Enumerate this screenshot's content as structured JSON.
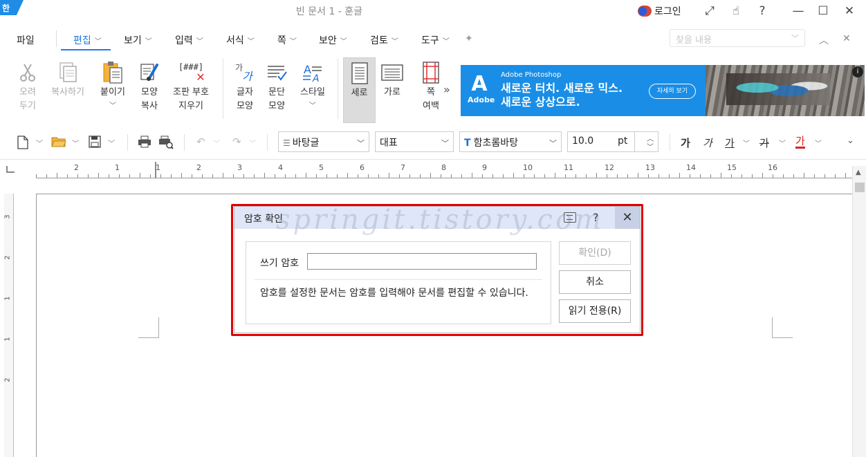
{
  "window": {
    "title": "빈 문서 1 - 훈글",
    "corner_badge": "한",
    "login_label": "로그인",
    "controls": [
      "expand-icon",
      "hand-icon",
      "help-icon",
      "minimize-icon",
      "maximize-icon",
      "close-icon"
    ]
  },
  "menu": {
    "file": "파일",
    "items": [
      "편집",
      "보기",
      "입력",
      "서식",
      "쪽",
      "보안",
      "검토",
      "도구"
    ],
    "active_index": 0,
    "search_placeholder": "찾을 내용"
  },
  "ribbon": {
    "cut": [
      "오려",
      "두기"
    ],
    "copy": "복사하기",
    "paste": "붙이기",
    "shape_copy": [
      "모양",
      "복사"
    ],
    "clear_codes": [
      "조판 부호",
      "지우기"
    ],
    "clear_codes_glyph": "[###]",
    "char_shape": [
      "글자",
      "모양"
    ],
    "para_shape": [
      "문단",
      "모양"
    ],
    "style": "스타일",
    "portrait": "세로",
    "landscape": "가로",
    "margin": [
      "쪽",
      "여백"
    ],
    "more": "»"
  },
  "ad": {
    "brand_small": "Adobe Photoshop",
    "logo_text": "Adobe",
    "headline": [
      "새로운 터치. 새로운 믹스.",
      "새로운 상상으로."
    ],
    "cta": "자세히 보기",
    "info": "i"
  },
  "format_bar": {
    "style_name": "바탕글",
    "lang": "대표",
    "font": "함초롬바탕",
    "font_size": "10.0",
    "unit": "pt",
    "bold_glyph": "가",
    "italic_glyph": "가",
    "underline_glyph": "가",
    "strike_glyph": "가",
    "color_glyph": "가"
  },
  "ruler": {
    "h_numbers": [
      "2",
      "1",
      "1",
      "2",
      "3",
      "4",
      "5",
      "6",
      "7",
      "8",
      "9",
      "10",
      "11",
      "12",
      "13",
      "14",
      "15",
      "16"
    ],
    "v_numbers": [
      "3",
      "2",
      "1",
      "1",
      "2"
    ]
  },
  "dialog": {
    "title": "암호 확인",
    "watermark": "springit.tistory.com",
    "help": "?",
    "close": "✕",
    "password_label": "쓰기 암호",
    "password_value": "",
    "description": "암호를 설정한 문서는 암호를 입력해야 문서를 편집할 수 있습니다.",
    "ok": "확인(D)",
    "cancel": "취소",
    "read_only": "읽기 전용(R)",
    "highlight_color": "#e00000"
  }
}
